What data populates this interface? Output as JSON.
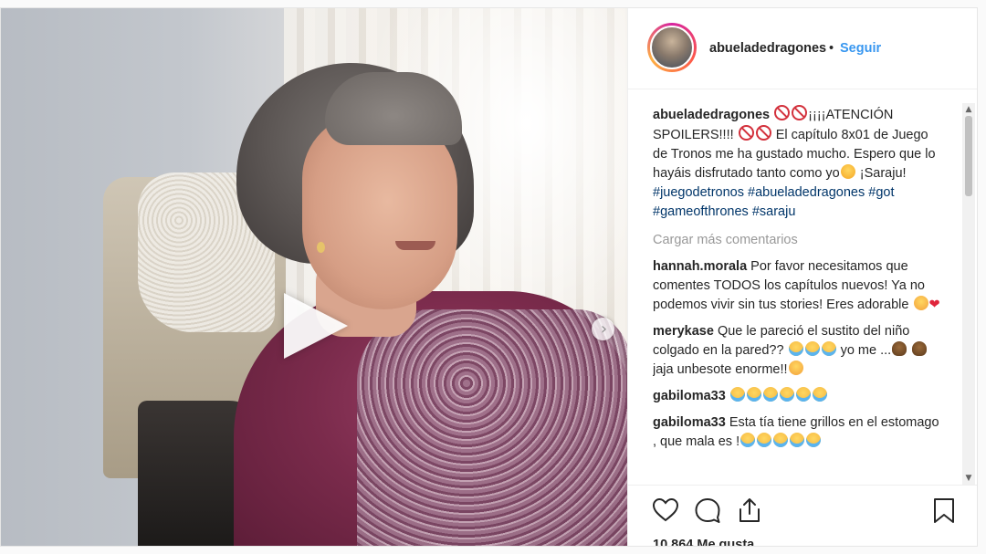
{
  "post": {
    "media": {
      "type": "video",
      "play_icon": "play-icon",
      "next_icon": "chevron-right-icon",
      "next_glyph": "›"
    },
    "header": {
      "username": "abueladedragones",
      "separator": "•",
      "follow_label": "Seguir"
    },
    "caption": {
      "username": "abueladedragones",
      "text_1": "¡¡¡¡ATENCIÓN SPOILERS!!!!",
      "text_2": "El capítulo 8x01 de Juego de Tronos me ha gustado mucho. Espero que lo hayáis disfrutado tanto como yo",
      "text_3": "¡Saraju!",
      "hashtags": [
        "#juegodetronos",
        "#abueladedragones",
        "#got",
        "#gameofthrones",
        "#saraju"
      ]
    },
    "load_more_label": "Cargar más comentarios",
    "comments": [
      {
        "username": "hannah.morala",
        "text": "Por favor necesitamos que comentes TODOS los capítulos nuevos! Ya no podemos vivir sin tus stories! Eres adorable"
      },
      {
        "username": "merykase",
        "text_1": "Que le pareció el sustito del niño colgado en la pared??",
        "text_2": "yo me ...",
        "text_3": "jaja unbesote enorme!!"
      },
      {
        "username": "gabiloma33",
        "text": ""
      },
      {
        "username": "gabiloma33",
        "text": "Esta tía tiene grillos en el estomago , que mala es !"
      }
    ],
    "actions": {
      "like_icon": "heart-icon",
      "comment_icon": "comment-icon",
      "share_icon": "share-icon",
      "save_icon": "bookmark-icon"
    },
    "likes": "10.864 Me gusta",
    "colors": {
      "link_blue": "#3897f0",
      "hashtag": "#003569",
      "muted": "#999999"
    }
  }
}
